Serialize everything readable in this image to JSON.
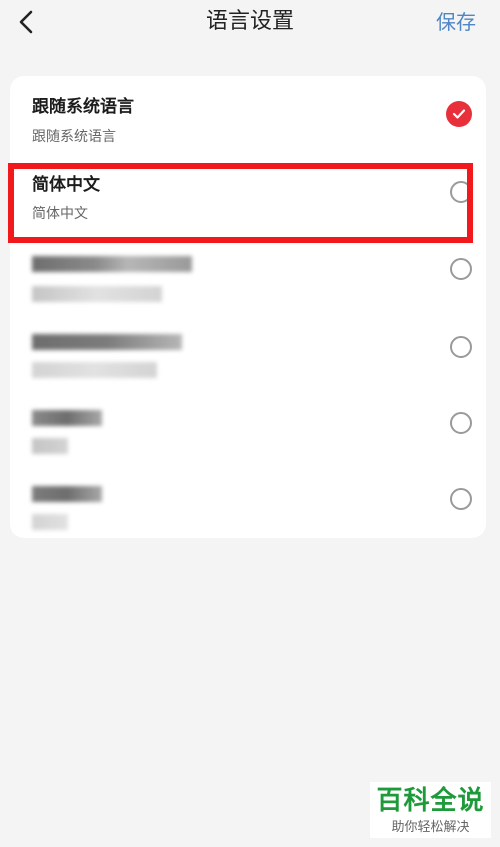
{
  "header": {
    "title": "语言设置",
    "save_label": "保存",
    "back_icon": "chevron-left-icon"
  },
  "languages": [
    {
      "name": "跟随系统语言",
      "native": "跟随系统语言",
      "selected": true
    },
    {
      "name": "简体中文",
      "native": "简体中文",
      "selected": false,
      "highlighted": true
    },
    {
      "name": "",
      "native": "",
      "selected": false,
      "blurred": true
    },
    {
      "name": "",
      "native": "",
      "selected": false,
      "blurred": true
    },
    {
      "name": "",
      "native": "",
      "selected": false,
      "blurred": true
    },
    {
      "name": "",
      "native": "",
      "selected": false,
      "blurred": true
    }
  ],
  "watermark": {
    "title": "百科全说",
    "subtitle": "助你轻松解决"
  },
  "colors": {
    "accent": "#4f86c5",
    "selected": "#e8303b",
    "highlight_border": "#f1191c",
    "watermark_green": "#1f9a3a",
    "background": "#f4f4f4"
  }
}
